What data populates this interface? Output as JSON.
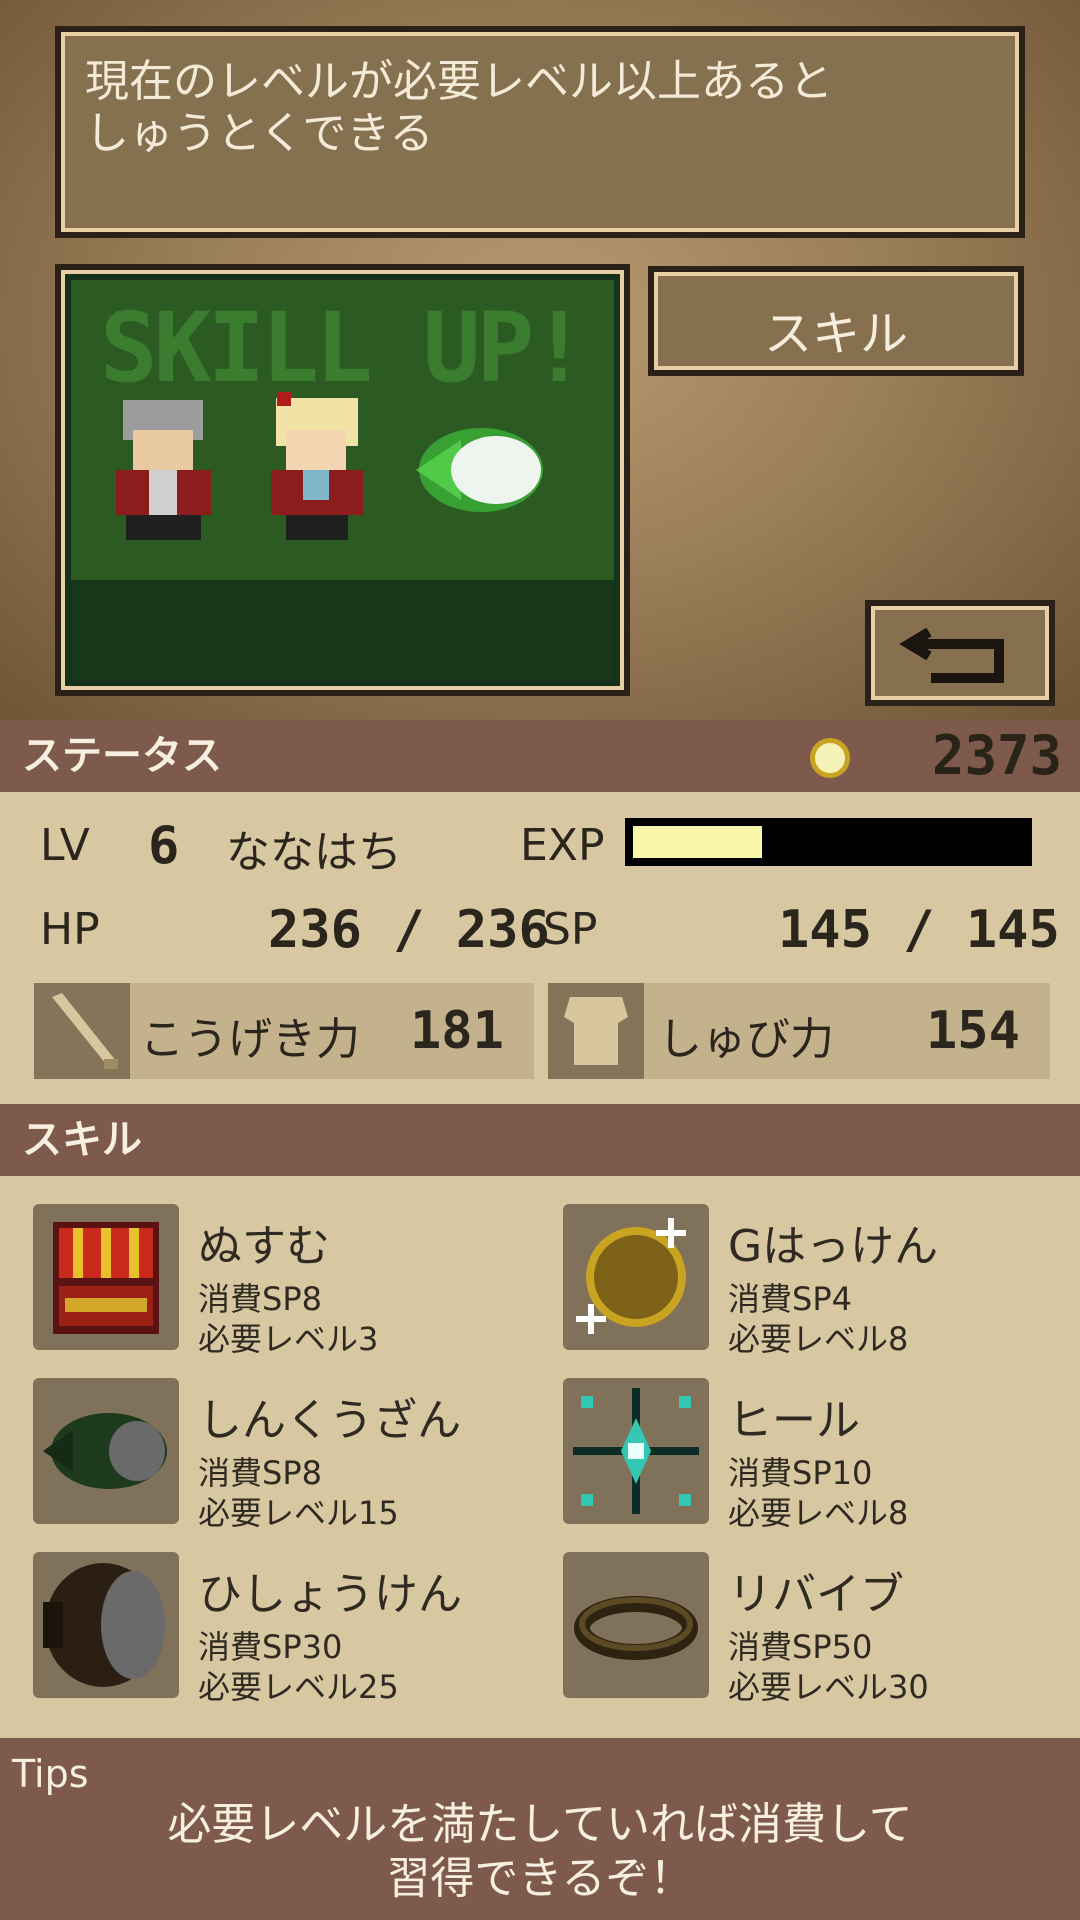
{
  "message": "現在のレベルが必要レベル以上あると\nしゅうとくできる",
  "preview": {
    "banner": "SKILL UP!"
  },
  "skill_tab_label": "スキル",
  "status": {
    "title": "ステータス",
    "gold": "2373",
    "lv_label": "LV",
    "lv_value": "6",
    "name": "ななはち",
    "exp_label": "EXP",
    "exp_fraction": 0.33,
    "hp_label": "HP",
    "hp_value": "236 / 236",
    "sp_label": "SP",
    "sp_value": "145 / 145",
    "attack_label": "こうげき力",
    "attack_value": "181",
    "defense_label": "しゅび力",
    "defense_value": "154"
  },
  "skills_title": "スキル",
  "skills": [
    {
      "name": "ぬすむ",
      "cost": "消費SP8",
      "req": "必要レベル3",
      "icon": "treasure-chest-icon"
    },
    {
      "name": "Gはっけん",
      "cost": "消費SP4",
      "req": "必要レベル8",
      "icon": "gold-coin-sparkle-icon"
    },
    {
      "name": "しんくうざん",
      "cost": "消費SP8",
      "req": "必要レベル15",
      "icon": "vacuum-slash-icon"
    },
    {
      "name": "ヒール",
      "cost": "消費SP10",
      "req": "必要レベル8",
      "icon": "heal-sparkle-icon"
    },
    {
      "name": "ひしょうけん",
      "cost": "消費SP30",
      "req": "必要レベル25",
      "icon": "flying-slash-icon"
    },
    {
      "name": "リバイブ",
      "cost": "消費SP50",
      "req": "必要レベル30",
      "icon": "halo-ring-icon"
    }
  ],
  "tips": {
    "label": "Tips",
    "text": "必要レベルを満たしていれば消費して\n習得できるぞ！"
  },
  "colors": {
    "section_bar": "#7d5a4b",
    "panel_bg": "#d8c8a2",
    "exp_fill": "#f8f6a8"
  }
}
